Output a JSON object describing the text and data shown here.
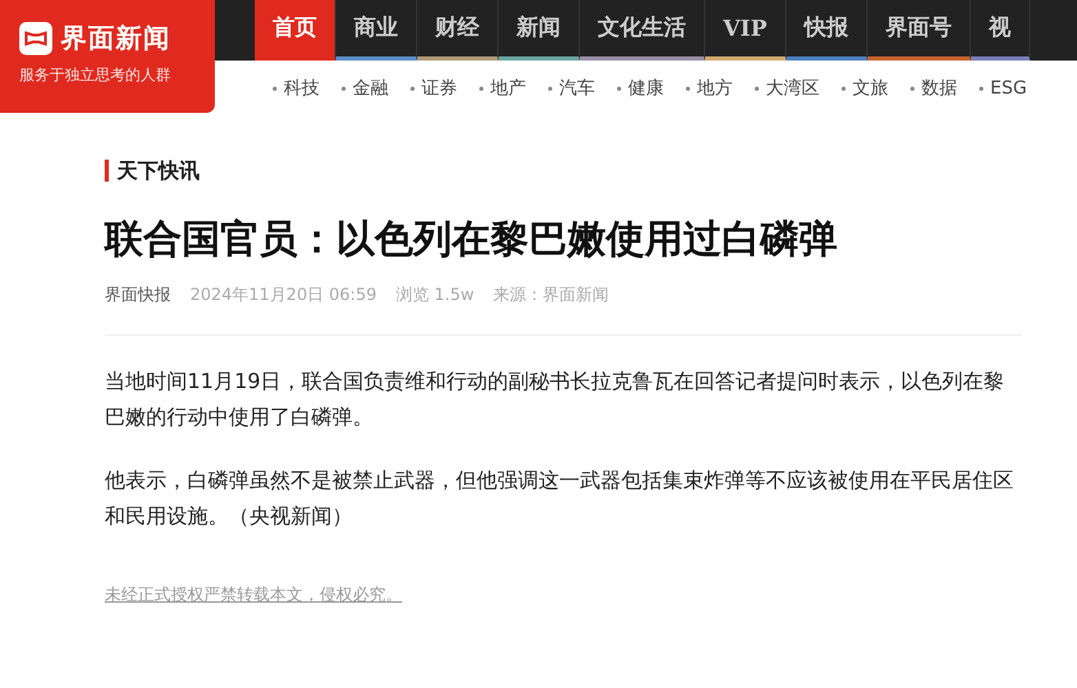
{
  "logo": {
    "name": "界面新闻",
    "slogan": "服务于独立思考的人群"
  },
  "nav_tabs": [
    {
      "label": "首页",
      "selected": true,
      "color": "#e02a1f"
    },
    {
      "label": "商业",
      "selected": false,
      "color": "#5b8fc7"
    },
    {
      "label": "财经",
      "selected": false,
      "color": "#b09a78"
    },
    {
      "label": "新闻",
      "selected": false,
      "color": "#6aa6a0"
    },
    {
      "label": "文化生活",
      "selected": false,
      "color": "#9a8fa6"
    },
    {
      "label": "VIP",
      "selected": false,
      "color": "#d1ab6e"
    },
    {
      "label": "快报",
      "selected": false,
      "color": "#4d80c0"
    },
    {
      "label": "界面号",
      "selected": false,
      "color": "#c8652f"
    },
    {
      "label": "视",
      "selected": false,
      "color": "#7a7fb8"
    }
  ],
  "sub_nav": [
    "科技",
    "金融",
    "证券",
    "地产",
    "汽车",
    "健康",
    "地方",
    "大湾区",
    "文旅",
    "数据",
    "ESG"
  ],
  "article": {
    "category": "天下快讯",
    "title": "联合国官员：以色列在黎巴嫩使用过白磷弹",
    "meta": {
      "author": "界面快报",
      "date": "2024年11月20日 06:59",
      "views": "浏览 1.5w",
      "source": "来源：界面新闻"
    },
    "paragraphs": [
      "当地时间11月19日，联合国负责维和行动的副秘书长拉克鲁瓦在回答记者提问时表示，以色列在黎巴嫩的行动中使用了白磷弹。",
      "他表示，白磷弹虽然不是被禁止武器，但他强调这一武器包括集束炸弹等不应该被使用在平民居住区和民用设施。（央视新闻）"
    ],
    "copyright": "未经正式授权严禁转载本文，侵权必究。"
  }
}
